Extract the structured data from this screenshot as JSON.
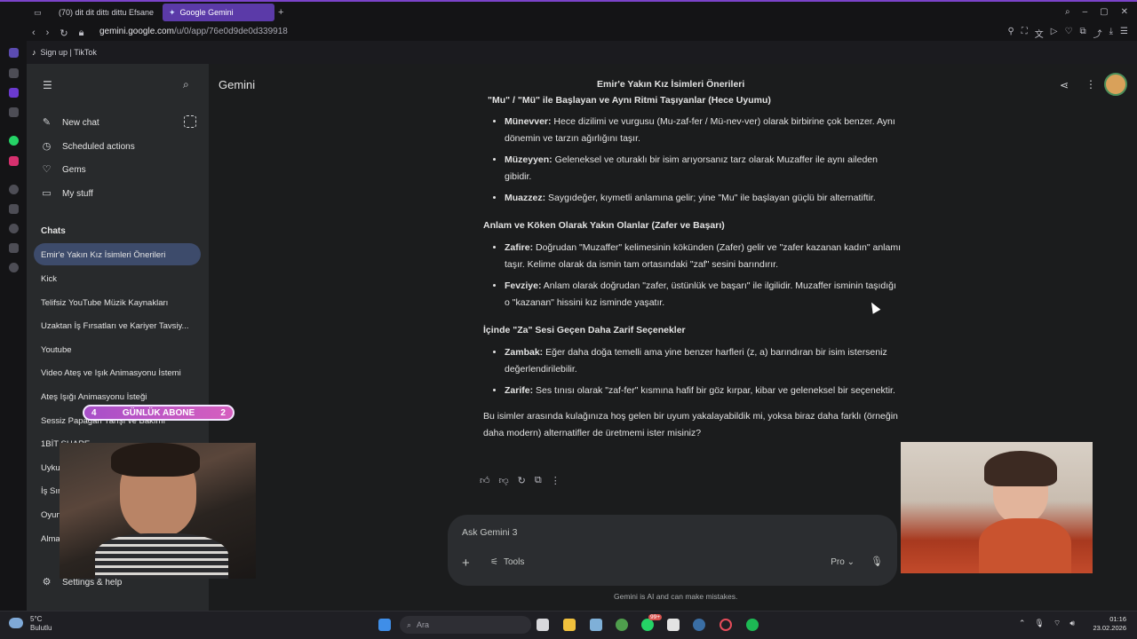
{
  "browser": {
    "tabs": [
      {
        "label": "(70) dit dit dittı dittu Efsane",
        "active": false
      },
      {
        "label": "Google Gemini",
        "active": true
      }
    ],
    "new_tab_glyph": "+",
    "url_domain": "gemini.google.com",
    "url_path": "/u/0/app/76e0d9de0d339918",
    "bookmark": "Sign up | TikTok"
  },
  "sidebar": {
    "new_chat": "New chat",
    "scheduled": "Scheduled actions",
    "gems": "Gems",
    "my_stuff": "My stuff",
    "chats_header": "Chats",
    "chats": [
      "Emir'e Yakın Kız İsimleri Önerileri",
      "Kick",
      "Telifsiz YouTube Müzik Kaynakları",
      "Uzaktan İş Fırsatları ve Kariyer Tavsiy...",
      "Youtube",
      "Video Ateş ve Işık Animasyonu İstemi",
      "Ateş Işığı Animasyonu İsteği",
      "Sessiz Papağan Yarışı ve Bakımı",
      "1BİT SHARE",
      "Uyku",
      "İş Sır",
      "Oyun",
      "Alma"
    ],
    "settings": "Settings & help"
  },
  "header": {
    "app_name": "Gemini",
    "conversation_title": "Emir'e Yakın Kız İsimleri Önerileri"
  },
  "response": {
    "section1_title": "\"Mu\" / \"Mü\" ile Başlayan ve Aynı Ritmi Taşıyanlar (Hece Uyumu)",
    "section1": [
      {
        "name": "Münevver:",
        "text": " Hece dizilimi ve vurgusu (Mu-zaf-fer / Mü-nev-ver) olarak birbirine çok benzer. Aynı dönemin ve tarzın ağırlığını taşır."
      },
      {
        "name": "Müzeyyen:",
        "text": " Geleneksel ve oturaklı bir isim arıyorsanız tarz olarak Muzaffer ile aynı aileden gibidir."
      },
      {
        "name": "Muazzez:",
        "text": " Saygıdeğer, kıymetli anlamına gelir; yine \"Mu\" ile başlayan güçlü bir alternatiftir."
      }
    ],
    "section2_title": "Anlam ve Köken Olarak Yakın Olanlar (Zafer ve Başarı)",
    "section2": [
      {
        "name": "Zafire:",
        "text": " Doğrudan \"Muzaffer\" kelimesinin kökünden (Zafer) gelir ve \"zafer kazanan kadın\" anlamı taşır. Kelime olarak da ismin tam ortasındaki \"zaf\" sesini barındırır."
      },
      {
        "name": "Fevziye:",
        "text": " Anlam olarak doğrudan \"zafer, üstünlük ve başarı\" ile ilgilidir. Muzaffer isminin taşıdığı o \"kazanan\" hissini kız isminde yaşatır."
      }
    ],
    "section3_title": "İçinde \"Za\" Sesi Geçen Daha Zarif Seçenekler",
    "section3": [
      {
        "name": "Zambak:",
        "text": " Eğer daha doğa temelli ama yine benzer harfleri (z, a) barındıran bir isim isterseniz değerlendirilebilir."
      },
      {
        "name": "Zarife:",
        "text": " Ses tınısı olarak \"zaf-fer\" kısmına hafif bir göz kırpar, kibar ve geleneksel bir seçenektir."
      }
    ],
    "closing": "Bu isimler arasında kulağınıza hoş gelen bir uyum yakalayabildik mi, yoksa biraz daha farklı (örneğin daha modern) alternatifler de üretmemi ister misiniz?"
  },
  "input": {
    "placeholder": "Ask Gemini 3",
    "tools": "Tools",
    "model": "Pro"
  },
  "disclaimer": "Gemini is AI and can make mistakes.",
  "overlay": {
    "left_num": "4",
    "label": "GÜNLÜK ABONE",
    "right_num": "2"
  },
  "taskbar": {
    "temp": "5°C",
    "condition": "Bulutlu",
    "search": "Ara",
    "time": "01:16",
    "date": "23.02.2026",
    "whatsapp_badge": "99+"
  },
  "colors": {
    "accent": "#7b43c9",
    "active_chat": "#3d4b6b",
    "background": "#1b1c1d"
  }
}
